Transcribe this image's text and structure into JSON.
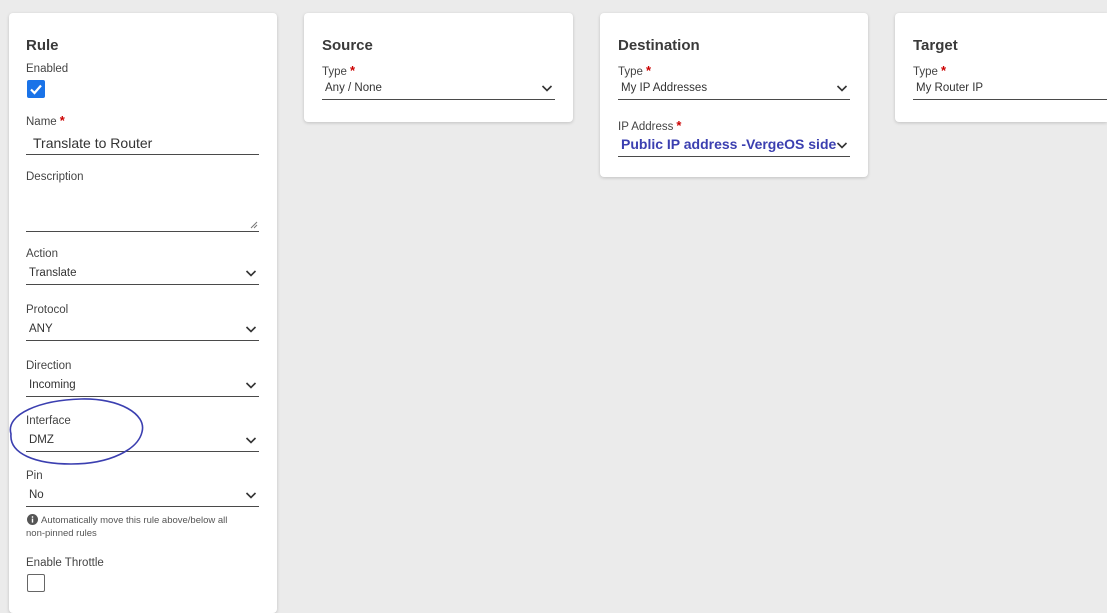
{
  "rule": {
    "title": "Rule",
    "enabled": {
      "label": "Enabled",
      "checked": true
    },
    "name": {
      "label": "Name",
      "value": "Translate to Router"
    },
    "description": {
      "label": "Description",
      "value": ""
    },
    "action": {
      "label": "Action",
      "value": "Translate"
    },
    "protocol": {
      "label": "Protocol",
      "value": "ANY"
    },
    "direction": {
      "label": "Direction",
      "value": "Incoming"
    },
    "interface": {
      "label": "Interface",
      "value": "DMZ"
    },
    "pin": {
      "label": "Pin",
      "value": "No",
      "hint": "Automatically move this rule above/below all non-pinned rules"
    },
    "enable_throttle": {
      "label": "Enable Throttle",
      "checked": false
    }
  },
  "source": {
    "title": "Source",
    "type": {
      "label": "Type",
      "value": "Any / None"
    }
  },
  "destination": {
    "title": "Destination",
    "type": {
      "label": "Type",
      "value": "My IP Addresses"
    },
    "ip_address": {
      "label": "IP Address",
      "value": "Public IP address -VergeOS side"
    }
  },
  "target": {
    "title": "Target",
    "type": {
      "label": "Type",
      "value": "My Router IP"
    }
  },
  "annotation": {
    "color": "#3b3fb0",
    "highlights": "interface"
  },
  "colors": {
    "checkbox_accent": "#1a73e8",
    "required": "#cc0000",
    "highlight_text": "#3b3fb0"
  }
}
